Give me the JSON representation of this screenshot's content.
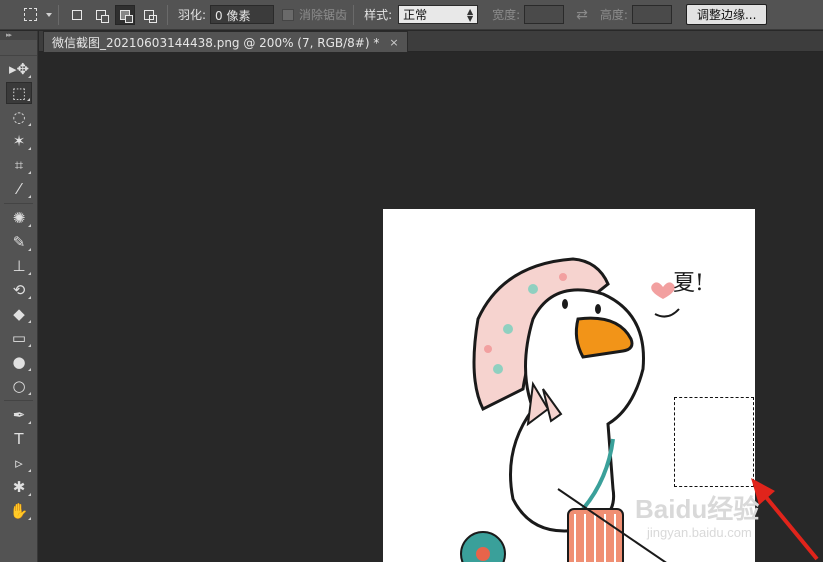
{
  "options_bar": {
    "feather_label": "羽化:",
    "feather_value": "0 像素",
    "antialias_label": "消除锯齿",
    "style_label": "样式:",
    "style_value": "正常",
    "width_label": "宽度:",
    "height_label": "高度:",
    "refine_edge_label": "调整边缘..."
  },
  "document_tab": {
    "title": "微信截图_20210603144438.png @ 200% (7, RGB/8#) *",
    "close_glyph": "×"
  },
  "toolbar": {
    "tools": [
      {
        "name": "move-tool",
        "glyph": "▸✥"
      },
      {
        "name": "rectangular-marquee-tool",
        "glyph": "⬚"
      },
      {
        "name": "lasso-tool",
        "glyph": "◌"
      },
      {
        "name": "magic-wand-tool",
        "glyph": "✶"
      },
      {
        "name": "crop-tool",
        "glyph": "⌗"
      },
      {
        "name": "eyedropper-tool",
        "glyph": "⁄"
      },
      {
        "name": "healing-brush-tool",
        "glyph": "✺"
      },
      {
        "name": "brush-tool",
        "glyph": "✎"
      },
      {
        "name": "clone-stamp-tool",
        "glyph": "⊥"
      },
      {
        "name": "history-brush-tool",
        "glyph": "⟲"
      },
      {
        "name": "eraser-tool",
        "glyph": "◆"
      },
      {
        "name": "gradient-tool",
        "glyph": "▭"
      },
      {
        "name": "blur-tool",
        "glyph": "●"
      },
      {
        "name": "dodge-tool",
        "glyph": "○"
      },
      {
        "name": "pen-tool",
        "glyph": "✒"
      },
      {
        "name": "type-tool",
        "glyph": "T"
      },
      {
        "name": "path-selection-tool",
        "glyph": "▹"
      },
      {
        "name": "custom-shape-tool",
        "glyph": "✱"
      },
      {
        "name": "hand-tool",
        "glyph": "✋"
      }
    ]
  },
  "canvas": {
    "watermark": "Baidu经验",
    "watermark_url": "jingyan.baidu.com",
    "sticker_text": "夏!"
  },
  "colors": {
    "accent_arrow": "#e0241b",
    "duck_beak": "#f29418",
    "scarf": "#f4c3c0"
  }
}
